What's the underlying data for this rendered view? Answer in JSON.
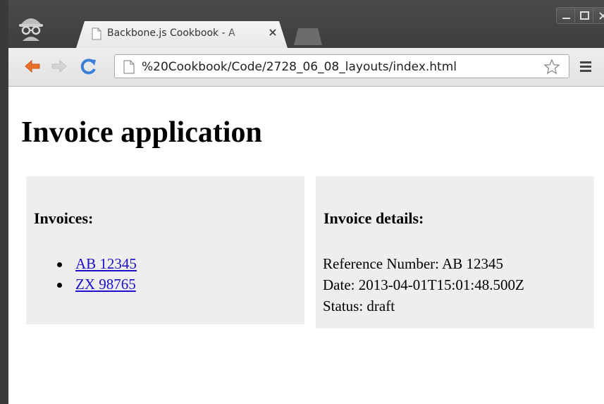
{
  "browser": {
    "tab_title": "Backbone.js Cookbook - A",
    "url": "%20Cookbook/Code/2728_06_08_layouts/index.html"
  },
  "page": {
    "heading": "Invoice application",
    "invoices_panel": {
      "title": "Invoices:",
      "items": [
        "AB 12345",
        "ZX 98765"
      ]
    },
    "details_panel": {
      "title": "Invoice details:",
      "reference": "Reference Number: AB 12345",
      "date": "Date: 2013-04-01T15:01:48.500Z",
      "status": "Status: draft"
    }
  },
  "icons": {
    "back": "back-arrow-icon",
    "forward": "forward-arrow-icon",
    "reload": "reload-icon",
    "page": "page-icon",
    "star": "star-icon",
    "menu": "menu-icon",
    "incognito": "incognito-icon"
  },
  "colors": {
    "link": "#1a0dcc",
    "panel_bg": "#eeeeee",
    "back_arrow": "#e8702a",
    "reload": "#3b7fd9"
  }
}
